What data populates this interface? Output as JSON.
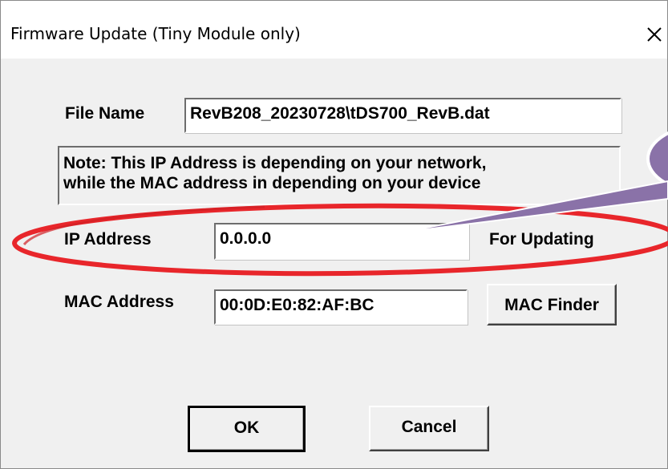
{
  "window": {
    "title": "Firmware Update (Tiny Module only)",
    "close_icon": "close-icon"
  },
  "form": {
    "file_name_label": "File Name",
    "file_name_value": "RevB208_20230728\\tDS700_RevB.dat",
    "note_line1": "Note: This IP Address is depending on your network,",
    "note_line2": "while the  MAC address in depending on your device",
    "ip_label": "IP Address",
    "ip_value": "0.0.0.0",
    "ip_hint": "For Updating",
    "mac_label": "MAC Address",
    "mac_value": "00:0D:E0:82:AF:BC",
    "mac_finder_label": "MAC Finder"
  },
  "buttons": {
    "ok_label": "OK",
    "cancel_label": "Cancel"
  },
  "annotation": {
    "highlight_color": "#e8262b",
    "callout_color": "#8a72a8"
  }
}
